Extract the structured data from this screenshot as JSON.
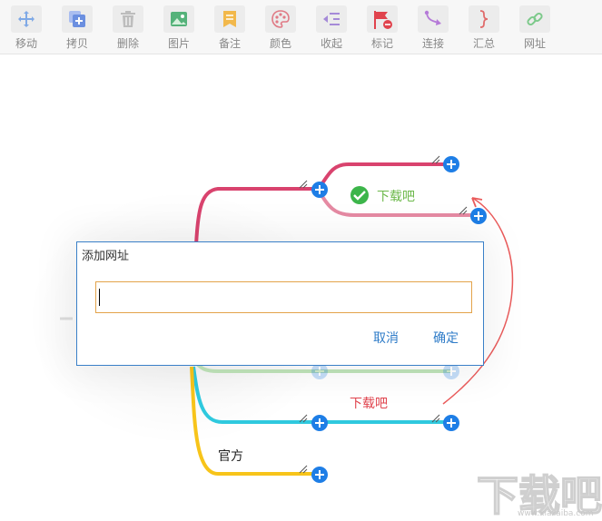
{
  "toolbar": {
    "items": [
      {
        "label": "移动",
        "icon": "move-icon",
        "color": "#7fa9e6"
      },
      {
        "label": "拷贝",
        "icon": "copy-icon",
        "color": "#6b8fe0"
      },
      {
        "label": "删除",
        "icon": "delete-icon",
        "color": "#bdbdbd"
      },
      {
        "label": "图片",
        "icon": "image-icon",
        "color": "#55b27a"
      },
      {
        "label": "备注",
        "icon": "note-icon",
        "color": "#f2b84b"
      },
      {
        "label": "颜色",
        "icon": "palette-icon",
        "color": "#e07a85"
      },
      {
        "label": "收起",
        "icon": "collapse-icon",
        "color": "#a58ad8"
      },
      {
        "label": "标记",
        "icon": "flag-icon",
        "color": "#e0434d"
      },
      {
        "label": "连接",
        "icon": "connect-icon",
        "color": "#b57ad8"
      },
      {
        "label": "汇总",
        "icon": "summary-icon",
        "color": "#e06b6b"
      },
      {
        "label": "网址",
        "icon": "link-icon",
        "color": "#7cc98a"
      }
    ]
  },
  "mindmap": {
    "node_downloadba_green": "下载吧",
    "node_downloadba_red": "下载吧",
    "node_official": "官方",
    "colors": {
      "pink_branch": "#d9436e",
      "cyan_branch": "#2fc9de",
      "yellow_branch": "#f7c41a",
      "green_branch": "#bfe4b9",
      "relation_line": "#ea5b5b",
      "plus_button": "#1e7ee6",
      "green_text": "#6cb84a",
      "red_text": "#e0434d"
    }
  },
  "dialog": {
    "title": "添加网址",
    "input_value": "",
    "cancel_label": "取消",
    "ok_label": "确定"
  },
  "watermark": {
    "text": "下载吧",
    "url": "www.xiazaiba.com"
  }
}
